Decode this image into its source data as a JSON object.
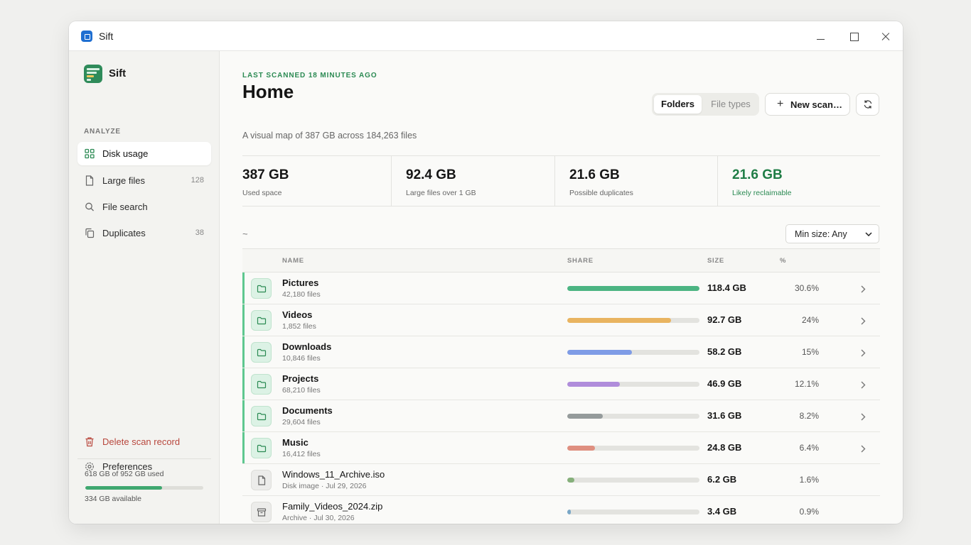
{
  "window": {
    "title": "Sift"
  },
  "sidebar": {
    "app_name": "Sift",
    "section_label": "ANALYZE",
    "items": [
      {
        "label": "Disk usage",
        "icon": "grid-icon",
        "count": "",
        "active": true
      },
      {
        "label": "Large files",
        "icon": "file-icon",
        "count": "128",
        "active": false
      },
      {
        "label": "File search",
        "icon": "search-icon",
        "count": "",
        "active": false
      },
      {
        "label": "Duplicates",
        "icon": "copy-icon",
        "count": "38",
        "active": false
      }
    ],
    "bottom_items": [
      {
        "label": "Delete scan record",
        "icon": "trash-icon"
      },
      {
        "label": "Preferences",
        "icon": "gear-icon"
      }
    ],
    "storage": {
      "used_text": "618 GB of 952 GB used",
      "used_fraction": 0.649,
      "available_text": "334 GB available"
    }
  },
  "header": {
    "eyebrow": "LAST SCANNED 18 MINUTES AGO",
    "title": "Home",
    "subtitle": "A visual map of 387 GB across 184,263 files",
    "segments": [
      {
        "label": "Folders",
        "active": true
      },
      {
        "label": "File types",
        "active": false
      }
    ],
    "new_scan_label": "New scan…"
  },
  "stats": [
    {
      "value": "387 GB",
      "label": "Used space",
      "highlight": false
    },
    {
      "value": "92.4 GB",
      "label": "Large files over 1 GB",
      "highlight": false
    },
    {
      "value": "21.6 GB",
      "label": "Possible duplicates",
      "highlight": false
    },
    {
      "value": "21.6 GB",
      "label": "Likely reclaimable",
      "highlight": true
    }
  ],
  "toolbar": {
    "path": "~",
    "min_size_label": "Min size: Any"
  },
  "table": {
    "columns": {
      "name": "NAME",
      "share": "SHARE",
      "size": "SIZE",
      "percent": "%"
    },
    "rows": [
      {
        "kind": "folder",
        "name": "Pictures",
        "meta": "42,180 files",
        "share": 1.0,
        "color": "#4cb583",
        "size": "118.4 GB",
        "percent": "30.6%"
      },
      {
        "kind": "folder",
        "name": "Videos",
        "meta": "1,852 files",
        "share": 0.784,
        "color": "#e9b460",
        "size": "92.7 GB",
        "percent": "24%"
      },
      {
        "kind": "folder",
        "name": "Downloads",
        "meta": "10,846 files",
        "share": 0.49,
        "color": "#7f9ce6",
        "size": "58.2 GB",
        "percent": "15%"
      },
      {
        "kind": "folder",
        "name": "Projects",
        "meta": "68,210 files",
        "share": 0.396,
        "color": "#b08ddb",
        "size": "46.9 GB",
        "percent": "12.1%"
      },
      {
        "kind": "folder",
        "name": "Documents",
        "meta": "29,604 files",
        "share": 0.268,
        "color": "#959b9b",
        "size": "31.6 GB",
        "percent": "8.2%"
      },
      {
        "kind": "folder",
        "name": "Music",
        "meta": "16,412 files",
        "share": 0.209,
        "color": "#df8f80",
        "size": "24.8 GB",
        "percent": "6.4%"
      },
      {
        "kind": "file",
        "icon": "document-icon",
        "name": "Windows_11_Archive.iso",
        "meta": "Disk image · Jul 29, 2026",
        "share": 0.052,
        "color": "#86b07b",
        "size": "6.2 GB",
        "percent": "1.6%"
      },
      {
        "kind": "file",
        "icon": "archive-icon",
        "name": "Family_Videos_2024.zip",
        "meta": "Archive · Jul 30, 2026",
        "share": 0.029,
        "color": "#7aa7c7",
        "size": "3.4 GB",
        "percent": "0.9%"
      }
    ]
  }
}
